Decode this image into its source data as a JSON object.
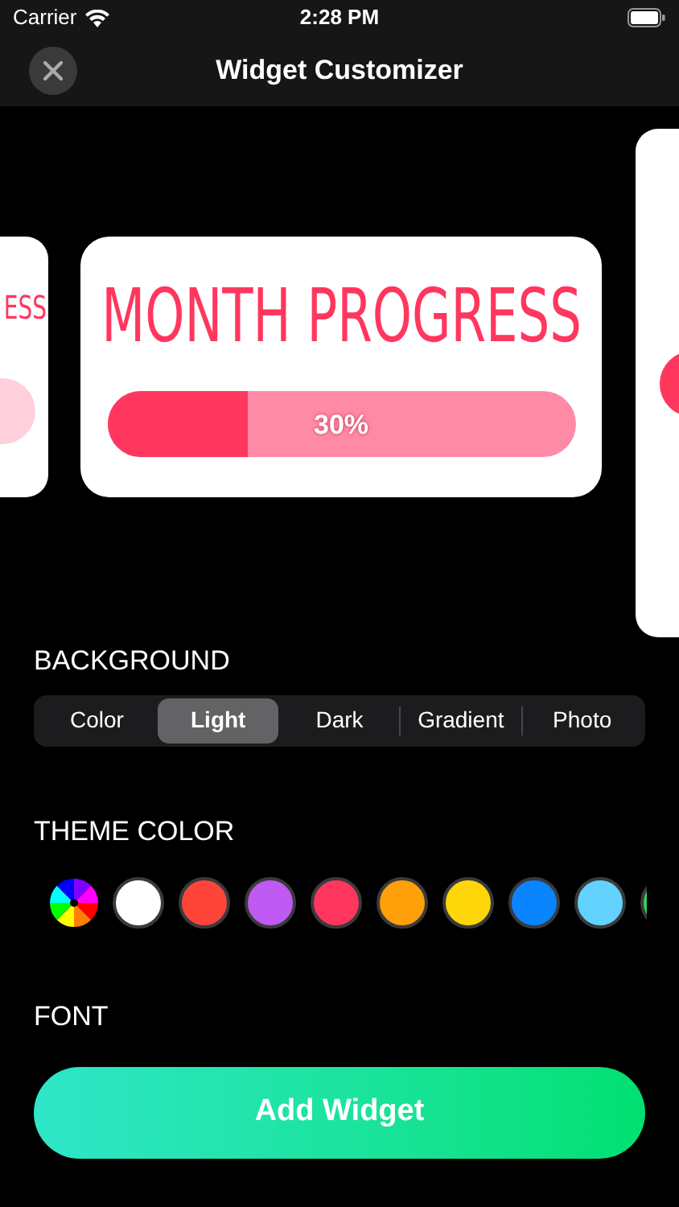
{
  "status_bar": {
    "carrier": "Carrier",
    "time": "2:28 PM"
  },
  "nav": {
    "title": "Widget Customizer"
  },
  "widgets": {
    "previous": {
      "title": "ESS",
      "level": 0.3
    },
    "next": {
      "level": 0.3
    },
    "current": {
      "title": "MONTH PROGRESS",
      "level": 0.3,
      "reading": "30%"
    }
  },
  "background": {
    "label": "BACKGROUND",
    "options": [
      {
        "label": "Color",
        "selected": false
      },
      {
        "label": "Light",
        "selected": true
      },
      {
        "label": "Dark",
        "selected": false
      },
      {
        "label": "Gradient",
        "selected": false
      },
      {
        "label": "Photo",
        "selected": false
      }
    ]
  },
  "theme_color": {
    "label": "THEME COLOR",
    "swatches": [
      {
        "kind": "wheel"
      },
      {
        "kind": "solid",
        "color": "#ffffff"
      },
      {
        "kind": "solid",
        "color": "#ff453a"
      },
      {
        "kind": "solid",
        "color": "#bf5af2"
      },
      {
        "kind": "solid",
        "color": "#ff375f"
      },
      {
        "kind": "solid",
        "color": "#ff9f0a"
      },
      {
        "kind": "solid",
        "color": "#ffd60a"
      },
      {
        "kind": "solid",
        "color": "#0a84ff"
      },
      {
        "kind": "solid",
        "color": "#64d2ff"
      },
      {
        "kind": "solid",
        "color": "#30d158"
      }
    ]
  },
  "font": {
    "label": "FONT"
  },
  "add_button": "Add Widget"
}
